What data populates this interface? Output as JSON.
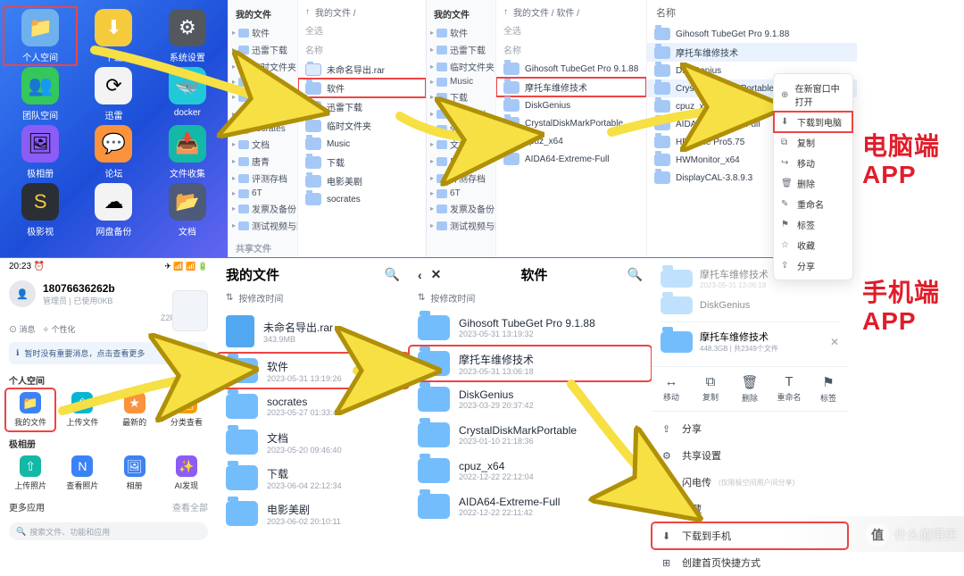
{
  "labels": {
    "desktop": "电脑端\nAPP",
    "mobile": "手机端\nAPP"
  },
  "launcher": {
    "items": [
      {
        "label": "个人空间",
        "icon": "📁",
        "cls": "li-blue",
        "hl": true
      },
      {
        "label": "下载",
        "icon": "⬇",
        "cls": "li-yellow"
      },
      {
        "label": "系统设置",
        "icon": "⚙",
        "cls": "li-gray"
      },
      {
        "label": "团队空间",
        "icon": "👥",
        "cls": "li-green"
      },
      {
        "label": "迅雷",
        "icon": "⟳",
        "cls": "li-white"
      },
      {
        "label": "docker",
        "icon": "🐳",
        "cls": "li-cyan"
      },
      {
        "label": "极相册",
        "icon": "🖼",
        "cls": "li-purple"
      },
      {
        "label": "论坛",
        "icon": "💬",
        "cls": "li-orange"
      },
      {
        "label": "文件收集",
        "icon": "📥",
        "cls": "li-teal"
      },
      {
        "label": "极影视",
        "icon": "S",
        "cls": "li-dark"
      },
      {
        "label": "网盘备份",
        "icon": "☁",
        "cls": "li-white"
      },
      {
        "label": "文档",
        "icon": "📂",
        "cls": "li-folder"
      }
    ]
  },
  "finder2": {
    "sidebar_title": "我的文件",
    "tree": [
      "软件",
      "迅雷下载",
      "临时文件夹",
      "Music",
      "下载",
      "电影美剧",
      "socrates",
      "文档",
      "唐青",
      "评测存档",
      "6T",
      "发票及备份",
      "测试视频与图片"
    ],
    "share_section": "共享文件",
    "crumb": "我的文件 /",
    "allsel": "全选",
    "col_head": "名称",
    "rows": [
      {
        "name": "未命名导出.rar",
        "file": true
      },
      {
        "name": "软件",
        "hl": true
      },
      {
        "name": "迅雷下载"
      },
      {
        "name": "临时文件夹"
      },
      {
        "name": "Music"
      },
      {
        "name": "下载"
      },
      {
        "name": "电影美剧"
      },
      {
        "name": "socrates"
      }
    ]
  },
  "finder3": {
    "sidebar_title": "我的文件",
    "tree": [
      "软件",
      "迅雷下载",
      "临时文件夹",
      "Music",
      "下载",
      "电影美剧",
      "socrates",
      "文档",
      "唐青",
      "评测存档",
      "6T",
      "发票及备份",
      "测试视频与图片"
    ],
    "crumb": "我的文件 / 软件 /",
    "allsel": "全选",
    "col_head": "名称",
    "rows": [
      {
        "name": "Gihosoft TubeGet Pro 9.1.88"
      },
      {
        "name": "摩托车维修技术",
        "hl": true
      },
      {
        "name": "DiskGenius"
      },
      {
        "name": "CrystalDiskMarkPortable"
      },
      {
        "name": "cpuz_x64"
      },
      {
        "name": "AIDA64-Extreme-Full"
      }
    ]
  },
  "panel4": {
    "head": "名称",
    "rows": [
      {
        "name": "Gihosoft TubeGet Pro 9.1.88"
      },
      {
        "name": "摩托车维修技术",
        "sel": true
      },
      {
        "name": "DiskGenius"
      },
      {
        "name": "CrystalDiskMarkPortable",
        "sel": true
      },
      {
        "name": "cpuz_x64"
      },
      {
        "name": "AIDA64-Extreme-Full"
      },
      {
        "name": "HD Tune Pro5.75"
      },
      {
        "name": "HWMonitor_x64"
      },
      {
        "name": "DisplayCAL-3.8.9.3"
      }
    ]
  },
  "context_menu": {
    "items": [
      {
        "icon": "⊕",
        "label": "在新窗口中打开"
      },
      {
        "icon": "⬇",
        "label": "下载到电脑",
        "hl": true
      },
      {
        "icon": "⧉",
        "label": "复制"
      },
      {
        "icon": "↪",
        "label": "移动"
      },
      {
        "icon": "🗑",
        "label": "删除"
      },
      {
        "icon": "✎",
        "label": "重命名"
      },
      {
        "icon": "⚑",
        "label": "标签"
      },
      {
        "icon": "☆",
        "label": "收藏"
      },
      {
        "icon": "⇪",
        "label": "分享"
      }
    ]
  },
  "mobile": {
    "time": "20:23",
    "clock_icon": "⏰",
    "status_icons": "✈ 📶 📶 🔋",
    "username": "18076636262b",
    "user_sub": "管理员 | 已使用0KB",
    "nas_model": "Z2Pro-NCM4",
    "chip1": "⊙ 消息",
    "chip2": "✧ 个性化",
    "notice": "暂时没有重要消息，点击查看更多",
    "sec1": "个人空间",
    "quick1": [
      {
        "label": "我的文件",
        "cls": "qc-blue",
        "icon": "📁",
        "hl": true
      },
      {
        "label": "上传文件",
        "cls": "qc-cyan",
        "icon": "⇧"
      },
      {
        "label": "最新的",
        "cls": "qc-orange",
        "icon": "★"
      },
      {
        "label": "分类查看",
        "cls": "qc-amber",
        "icon": "🗂"
      }
    ],
    "sec2": "极相册",
    "quick2": [
      {
        "label": "上传照片",
        "cls": "qc-teal",
        "icon": "⇧"
      },
      {
        "label": "查看照片",
        "cls": "qc-green",
        "icon": "N"
      },
      {
        "label": "相册",
        "cls": "qc-blue",
        "icon": "🖼"
      },
      {
        "label": "AI发现",
        "cls": "qc-purple",
        "icon": "✨"
      }
    ],
    "more": "更多应用",
    "see_all": "查看全部",
    "search_ph": "搜索文件、功能和应用"
  },
  "mlist7": {
    "title": "我的文件",
    "sort": "按修改时间",
    "rows": [
      {
        "name": "未命名导出.rar",
        "sub": "343.9MB",
        "file": true
      },
      {
        "name": "软件",
        "sub": "2023-05-31 13:19:26",
        "hl": true
      },
      {
        "name": "socrates",
        "sub": "2023-05-27 01:33:42"
      },
      {
        "name": "文档",
        "sub": "2023-05-20 09:46:40"
      },
      {
        "name": "下载",
        "sub": "2023-06-04 22:12:34"
      },
      {
        "name": "电影美剧",
        "sub": "2023-06-02 20:10:11"
      }
    ]
  },
  "mlist8": {
    "title": "软件",
    "sort": "按修改时间",
    "rows": [
      {
        "name": "Gihosoft TubeGet Pro 9.1.88",
        "sub": "2023-05-31 13:19:32"
      },
      {
        "name": "摩托车维修技术",
        "sub": "2023-05-31 13:06:18",
        "hl": true
      },
      {
        "name": "DiskGenius",
        "sub": "2023-03-29 20:37:42"
      },
      {
        "name": "CrystalDiskMarkPortable",
        "sub": "2023-01-10 21:18:36"
      },
      {
        "name": "cpuz_x64",
        "sub": "2022-12-22 22:12:04"
      },
      {
        "name": "AIDA64-Extreme-Full",
        "sub": "2022-12-22 22:11:42"
      }
    ]
  },
  "detail": {
    "preview1": {
      "name": "摩托车维修技术",
      "sub": "2023-05-31 13:06:18"
    },
    "preview2": {
      "name": "DiskGenius"
    },
    "header": {
      "name": "摩托车维修技术",
      "sub": "448.3GB | 共2349个文件"
    },
    "actions": [
      {
        "icon": "↔",
        "label": "移动"
      },
      {
        "icon": "⧉",
        "label": "复制"
      },
      {
        "icon": "🗑",
        "label": "删除"
      },
      {
        "icon": "T",
        "label": "重命名"
      },
      {
        "icon": "⚑",
        "label": "标签"
      }
    ],
    "options": [
      {
        "icon": "⇪",
        "label": "分享"
      },
      {
        "icon": "⚙",
        "label": "共享设置"
      },
      {
        "icon": "⚡",
        "label": "闪电传",
        "hint": "(仅限极空间用户间分享)"
      },
      {
        "icon": "☆",
        "label": "收藏"
      },
      {
        "icon": "⬇",
        "label": "下载到手机",
        "hl": true
      },
      {
        "icon": "⊞",
        "label": "创建首页快捷方式"
      }
    ]
  },
  "watermark": "什么值得买"
}
